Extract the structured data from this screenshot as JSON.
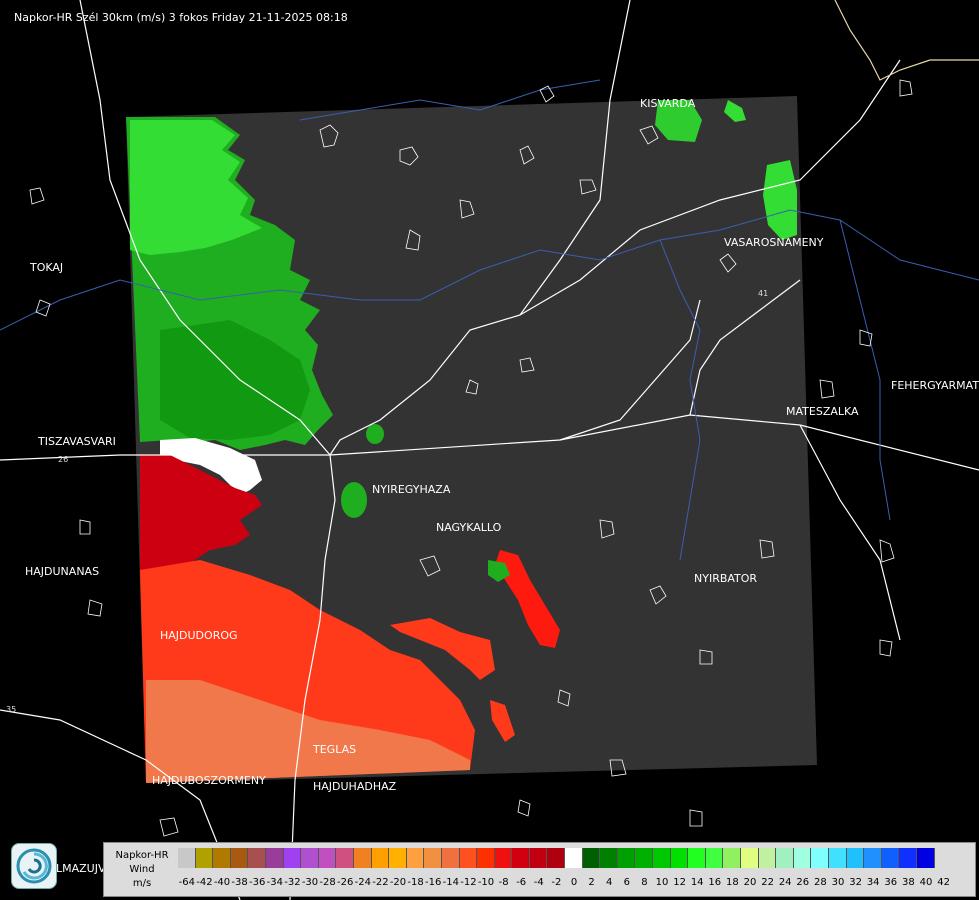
{
  "title": "Napkor-HR Szél 30km (m/s) 3 fokos Friday 21-11-2025 08:18",
  "towns": [
    {
      "name": "KISVARDA",
      "id": "kisvarda"
    },
    {
      "name": "VASAROSNAMENY",
      "id": "vasarosnameny"
    },
    {
      "name": "TOKAJ",
      "id": "tokaj"
    },
    {
      "name": "FEHERGYARMAT",
      "id": "fehergyarmat"
    },
    {
      "name": "MATESZALKA",
      "id": "mateszalka"
    },
    {
      "name": "TISZAVASVARI",
      "id": "tiszavasvari"
    },
    {
      "name": "NYIREGYHAZA",
      "id": "nyiregyhaza"
    },
    {
      "name": "NAGYKALLO",
      "id": "nagykallo"
    },
    {
      "name": "HAJDUNANAS",
      "id": "hajdunanas"
    },
    {
      "name": "NYIRBATOR",
      "id": "nyirbator"
    },
    {
      "name": "HAJDUDOROG",
      "id": "hajdudorog"
    },
    {
      "name": "TEGLAS",
      "id": "teglas"
    },
    {
      "name": "HAJDUBOSZORMENY",
      "id": "hajduboszormeny"
    },
    {
      "name": "HAJDUHADHAZ",
      "id": "hajduhadhaz"
    }
  ],
  "road_numbers": [
    "26",
    "41",
    "35"
  ],
  "partial_label": "LMAZUJVAR",
  "legend": {
    "line1": "Napkor-HR",
    "line2": "Wind",
    "line3": "m/s",
    "ticks": [
      "-64",
      "-42",
      "-40",
      "-38",
      "-36",
      "-34",
      "-32",
      "-30",
      "-28",
      "-26",
      "-24",
      "-22",
      "-20",
      "-18",
      "-16",
      "-14",
      "-12",
      "-10",
      "-8",
      "-6",
      "-4",
      "-2",
      "0",
      "2",
      "4",
      "6",
      "8",
      "10",
      "12",
      "14",
      "16",
      "18",
      "20",
      "22",
      "24",
      "26",
      "28",
      "30",
      "32",
      "34",
      "36",
      "38",
      "40",
      "42"
    ],
    "colors": [
      "#c8c8c8",
      "#b0a000",
      "#b07a00",
      "#a85a10",
      "#a85050",
      "#9a3c9a",
      "#a040f0",
      "#b050d0",
      "#c050c0",
      "#d05080",
      "#f08020",
      "#ffa000",
      "#ffb000",
      "#ffa040",
      "#f09040",
      "#f07040",
      "#ff5020",
      "#ff3000",
      "#f01010",
      "#d00010",
      "#c00010",
      "#b00010",
      "#ffffff",
      "#006000",
      "#008000",
      "#00a000",
      "#00b000",
      "#00c800",
      "#00e000",
      "#20ff20",
      "#40ff40",
      "#90f060",
      "#e0ff80",
      "#c0f0a0",
      "#a0f0c0",
      "#a0ffe0",
      "#80ffff",
      "#40e0ff",
      "#20c0ff",
      "#2090ff",
      "#1060ff",
      "#1030ff",
      "#0000e0"
    ]
  }
}
